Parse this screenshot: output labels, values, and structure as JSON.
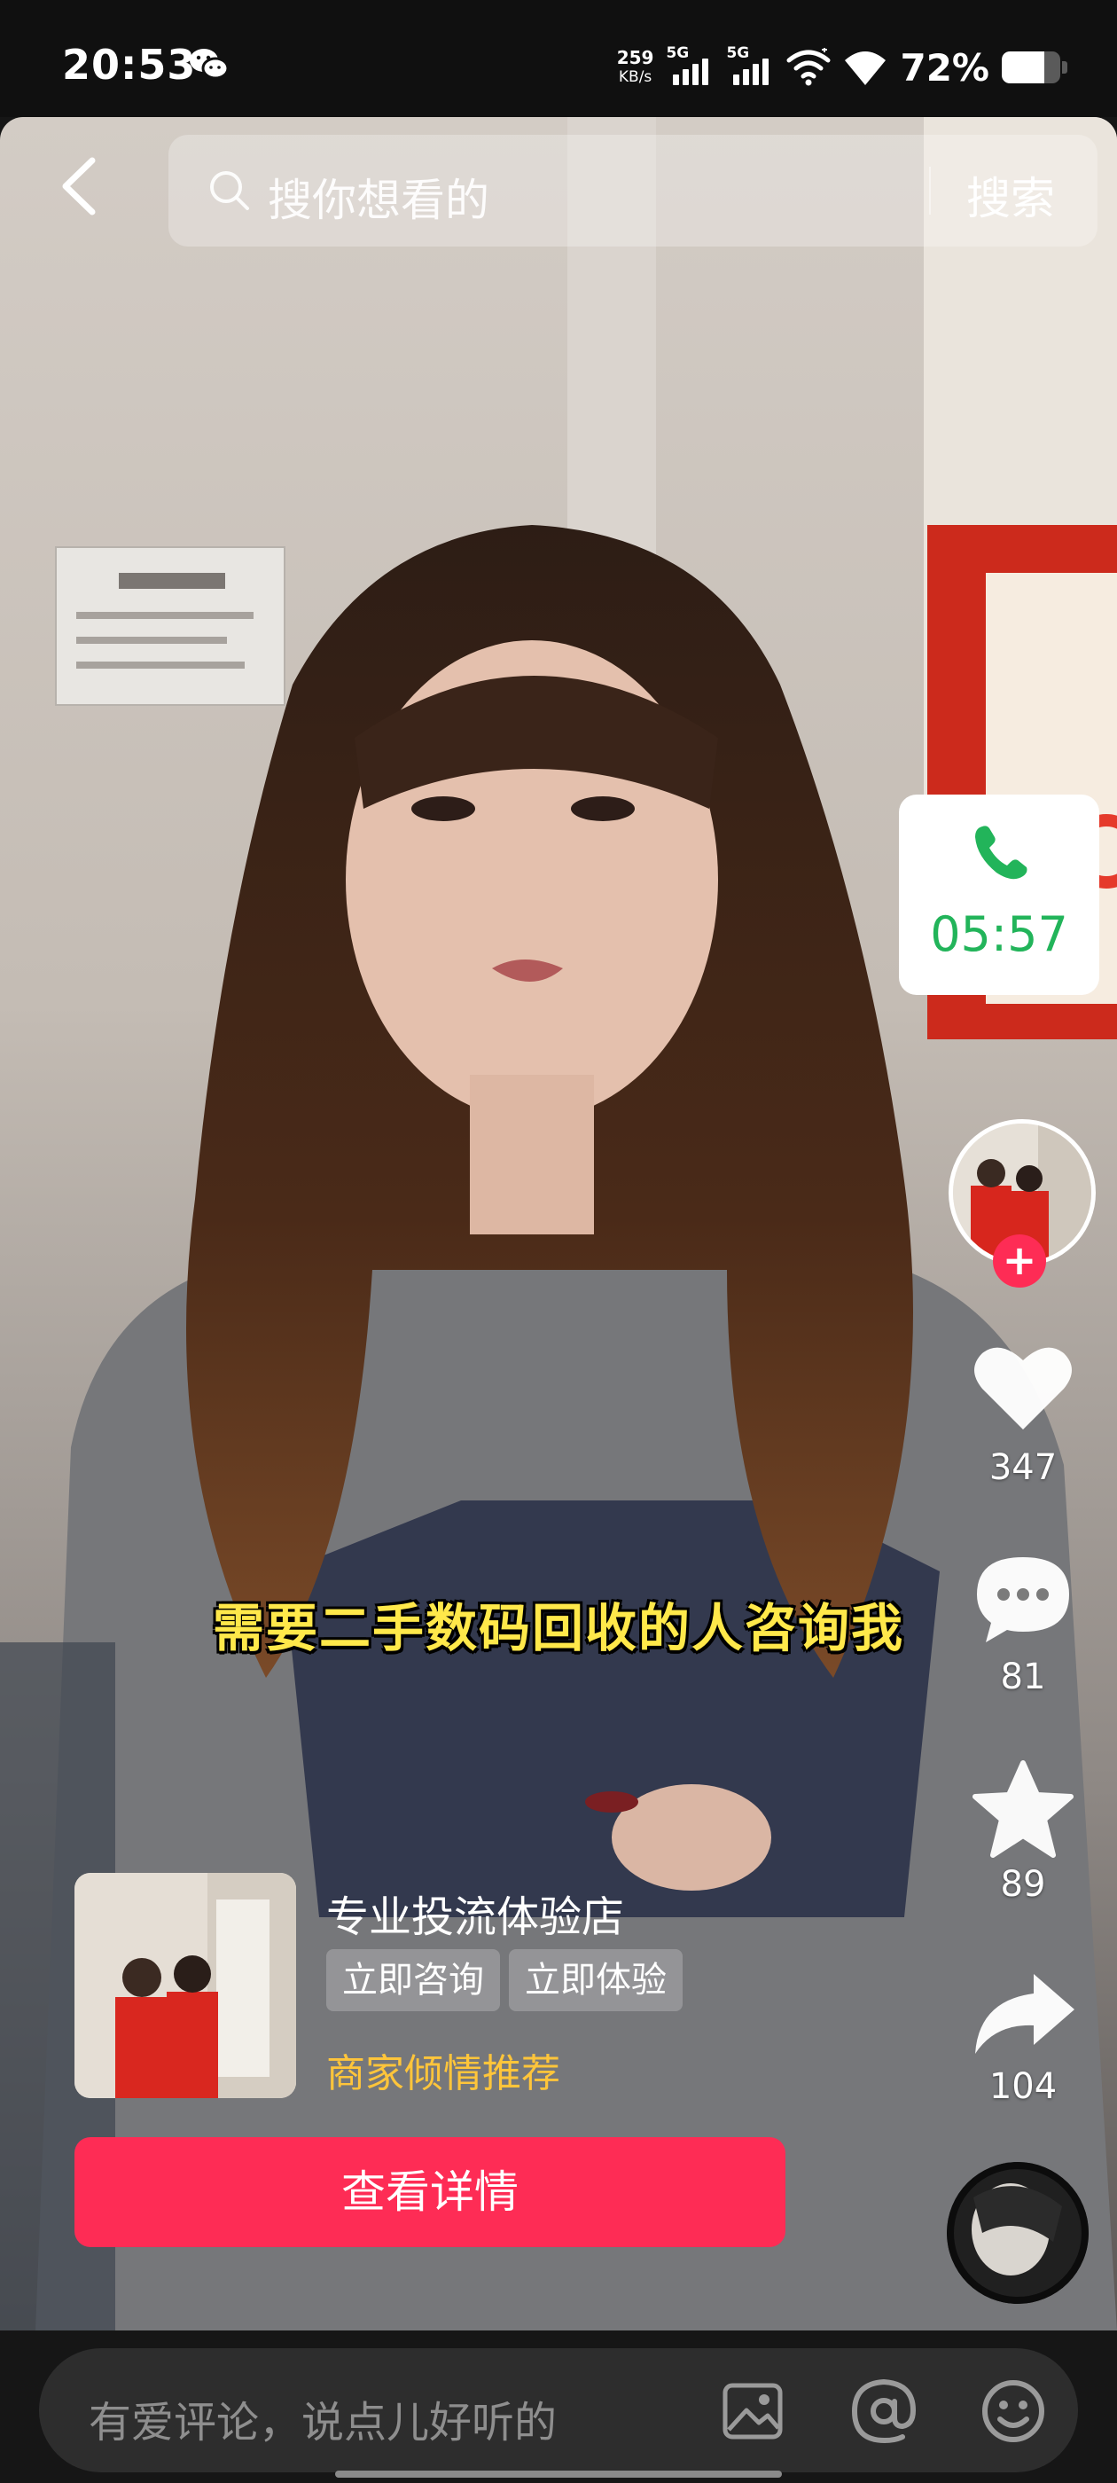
{
  "status_bar": {
    "time": "20:53",
    "net_speed_value": "259",
    "net_speed_unit": "KB/s",
    "sim1_label": "5G",
    "sim2_label": "5G",
    "battery_percent": "72%",
    "battery_level": 0.72,
    "icons": [
      "wechat-icon",
      "signal-icon",
      "signal-icon",
      "hotspot-icon",
      "wifi-icon",
      "battery-icon"
    ]
  },
  "search": {
    "placeholder": "搜你想看的",
    "button_label": "搜索"
  },
  "video": {
    "caption": "需要二手数码回收的人咨询我"
  },
  "call_widget": {
    "timer": "05:57",
    "accent_color": "#22b45a"
  },
  "actions": {
    "likes": "347",
    "comments": "81",
    "favorites": "89",
    "shares": "104"
  },
  "promo": {
    "shop_name": "专业投流体验店",
    "tags": [
      "立即咨询",
      "立即体验"
    ],
    "recommend_text": "商家倾情推荐",
    "cta_label": "查看详情",
    "cta_color": "#fe2c55"
  },
  "comment_bar": {
    "placeholder": "有爱评论，说点儿好听的",
    "icons": [
      "image-icon",
      "at-icon",
      "emoji-icon"
    ]
  }
}
